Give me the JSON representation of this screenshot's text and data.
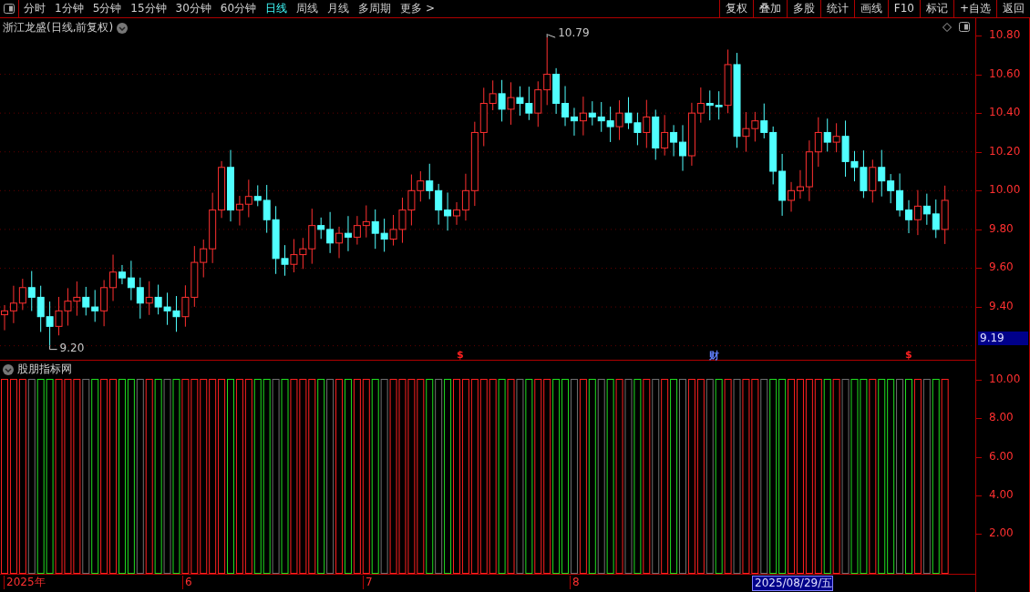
{
  "toolbar": {
    "periods": [
      {
        "label": "分时",
        "selected": false
      },
      {
        "label": "1分钟",
        "selected": false
      },
      {
        "label": "5分钟",
        "selected": false
      },
      {
        "label": "15分钟",
        "selected": false
      },
      {
        "label": "30分钟",
        "selected": false
      },
      {
        "label": "60分钟",
        "selected": false
      },
      {
        "label": "日线",
        "selected": true
      },
      {
        "label": "周线",
        "selected": false
      },
      {
        "label": "月线",
        "selected": false
      },
      {
        "label": "多周期",
        "selected": false
      }
    ],
    "more": "更多 >",
    "buttons": [
      "复权",
      "叠加",
      "多股",
      "统计",
      "画线",
      "F10",
      "标记",
      "+自选",
      "返回"
    ]
  },
  "price_panel": {
    "title": "浙江龙盛(日线,前复权)",
    "axis_labels": [
      "10.80",
      "10.60",
      "10.40",
      "10.20",
      "10.00",
      "9.80",
      "9.60",
      "9.40"
    ],
    "price_tag": "9.19",
    "high_label": "10.79",
    "low_label": "9.20",
    "markers": [
      {
        "text": "$",
        "color": "#ff2020"
      },
      {
        "text": "财",
        "color": "#6080ff"
      },
      {
        "text": "$",
        "color": "#ff2020"
      }
    ]
  },
  "indicator_panel": {
    "title": "股朋指标网",
    "axis_labels": [
      "10.00",
      "8.00",
      "6.00",
      "4.00",
      "2.00"
    ]
  },
  "date_axis": {
    "labels": [
      {
        "label": "2025年",
        "selected": false
      },
      {
        "label": "6",
        "selected": false
      },
      {
        "label": "7",
        "selected": false
      },
      {
        "label": "8",
        "selected": false
      },
      {
        "label": "2025/08/29/五",
        "selected": true
      }
    ]
  }
}
